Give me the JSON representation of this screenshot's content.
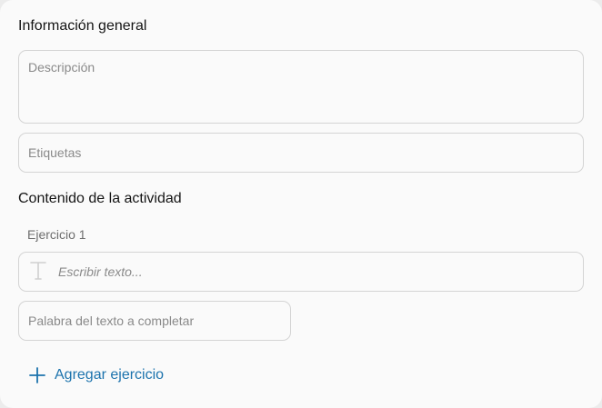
{
  "general": {
    "title": "Información general",
    "description_placeholder": "Descripción",
    "tags_placeholder": "Etiquetas"
  },
  "content": {
    "title": "Contenido de la actividad",
    "exercise_label": "Ejercicio 1",
    "text_placeholder": "Escribir texto...",
    "word_placeholder": "Palabra del texto a completar",
    "add_exercise_label": "Agregar ejercicio"
  },
  "icons": {
    "text_format": "text-format-icon",
    "add": "plus-icon"
  },
  "colors": {
    "accent": "#1c73ad",
    "border": "#d4d4d4",
    "placeholder": "#8a8a8a"
  }
}
